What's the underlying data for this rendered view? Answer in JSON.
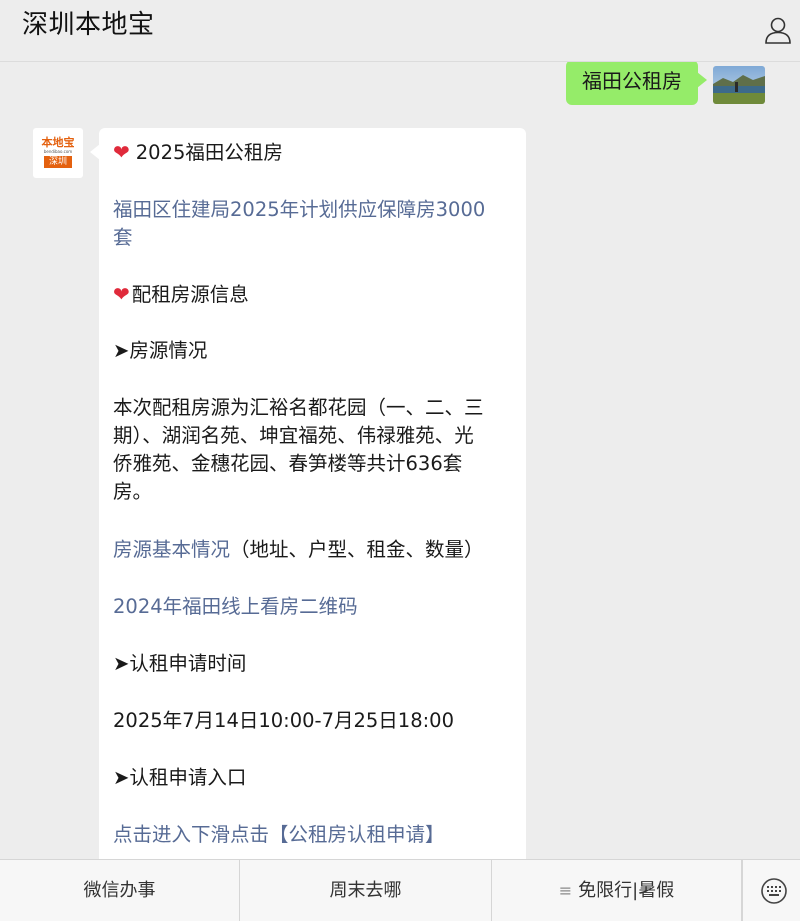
{
  "header": {
    "title": "深圳本地宝",
    "profile_icon": "person-icon"
  },
  "outgoing": {
    "text": "福田公租房"
  },
  "incoming": {
    "avatar": {
      "logo_text": "本地宝",
      "logo_url": "bendibao.com",
      "city_tag": "深圳"
    },
    "lines": {
      "title": "2025福田公租房",
      "link1_a": "福田区住建局2025年计划供应保障房3000",
      "link1_b": "套",
      "section1": "配租房源信息",
      "sub1": "➤房源情况",
      "para_a": "本次配租房源为汇裕名都花园（一、二、三",
      "para_b": "期）、湖润名苑、坤宜福苑、伟禄雅苑、光",
      "para_c": "侨雅苑、金穗花园、春笋楼等共计636套",
      "para_d": "房。",
      "link2": "房源基本情况",
      "link2_suffix": "（地址、户型、租金、数量）",
      "link3": "2024年福田线上看房二维码",
      "sub2": "➤认租申请时间",
      "time": "2025年7月14日10:00-7月25日18:00",
      "sub3": "➤认租申请入口",
      "link4": "点击进入下滑点击【公租房认租申请】"
    },
    "heart_icon": "❤"
  },
  "menu": {
    "items": [
      "微信办事",
      "周末去哪",
      "免限行|暑假"
    ],
    "menu_icon": "≡"
  },
  "colors": {
    "background": "#ededed",
    "outgoing_bubble": "#95ec69",
    "link": "#576b95",
    "heart": "#e02a3b",
    "brand_orange": "#e4610f"
  }
}
